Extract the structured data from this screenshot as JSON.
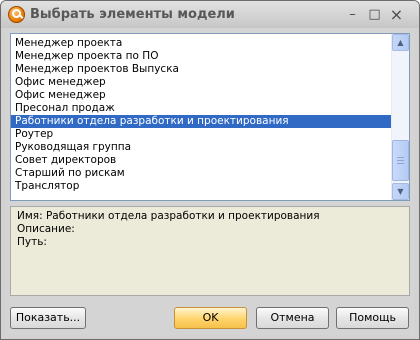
{
  "window": {
    "title": "Выбрать элементы модели",
    "minimize": "–",
    "maximize": "□",
    "close": "×"
  },
  "list": {
    "items": [
      "Менеджер проекта",
      "Менеджер проекта по ПО",
      "Менеджер проектов Выпуска",
      "Офис менеджер",
      "Офис менеджер",
      "Пресонал продаж",
      "Работники отдела разработки и проектирования",
      "Роутер",
      "Руководящая группа",
      "Совет директоров",
      "Старший по рискам",
      "Транслятор"
    ],
    "selected_index": 6,
    "scroll_up": "▲",
    "scroll_down": "▼"
  },
  "info": {
    "name_line": "Имя: Работники отдела разработки и проектирования",
    "description_line": "Описание:",
    "path_line": "Путь:"
  },
  "buttons": {
    "show": "Показать...",
    "ok": "OK",
    "cancel": "Отмена",
    "help": "Помощь"
  }
}
